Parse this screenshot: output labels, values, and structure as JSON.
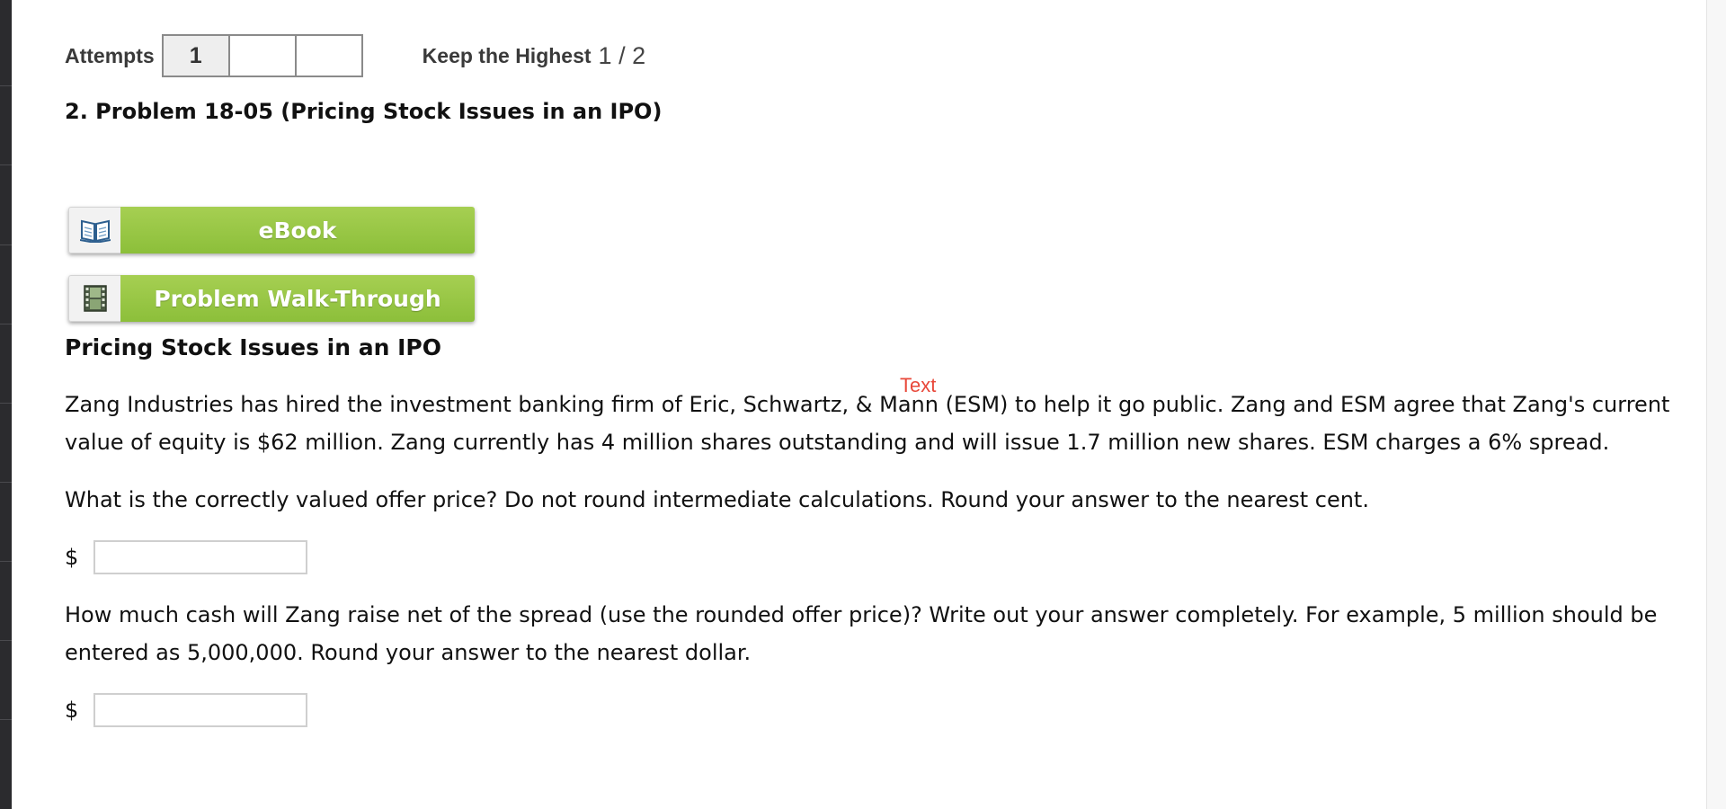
{
  "attempts": {
    "label": "Attempts",
    "boxes": [
      "1",
      "",
      ""
    ],
    "keep_label": "Keep the Highest",
    "score": "1 / 2"
  },
  "problem": {
    "title": "2.  Problem 18-05 (Pricing Stock Issues in an IPO)"
  },
  "resources": {
    "ebook_label": "eBook",
    "ebook_icon": "book-icon",
    "walkthrough_label": "Problem Walk-Through",
    "walkthrough_icon": "film-icon"
  },
  "section_title": "Pricing Stock Issues in an IPO",
  "annotation": "Text",
  "paragraph_1": "Zang Industries has hired the investment banking firm of Eric, Schwartz, & Mann (ESM) to help it go public. Zang and ESM agree that Zang's current value of equity is $62 million. Zang currently has 4 million shares outstanding and will issue 1.7 million new shares. ESM charges a 6% spread.",
  "question_1": "What is the correctly valued offer price? Do not round intermediate calculations. Round your answer to the nearest cent.",
  "answer_1": {
    "currency": "$",
    "value": ""
  },
  "question_2": "How much cash will Zang raise net of the spread (use the rounded offer price)? Write out your answer completely. For example, 5 million should be entered as 5,000,000. Round your answer to the nearest dollar.",
  "answer_2": {
    "currency": "$",
    "value": ""
  },
  "colors": {
    "button_green": "#95c644",
    "annotation_red": "#e8483a",
    "left_rail": "#2b2b2e"
  }
}
